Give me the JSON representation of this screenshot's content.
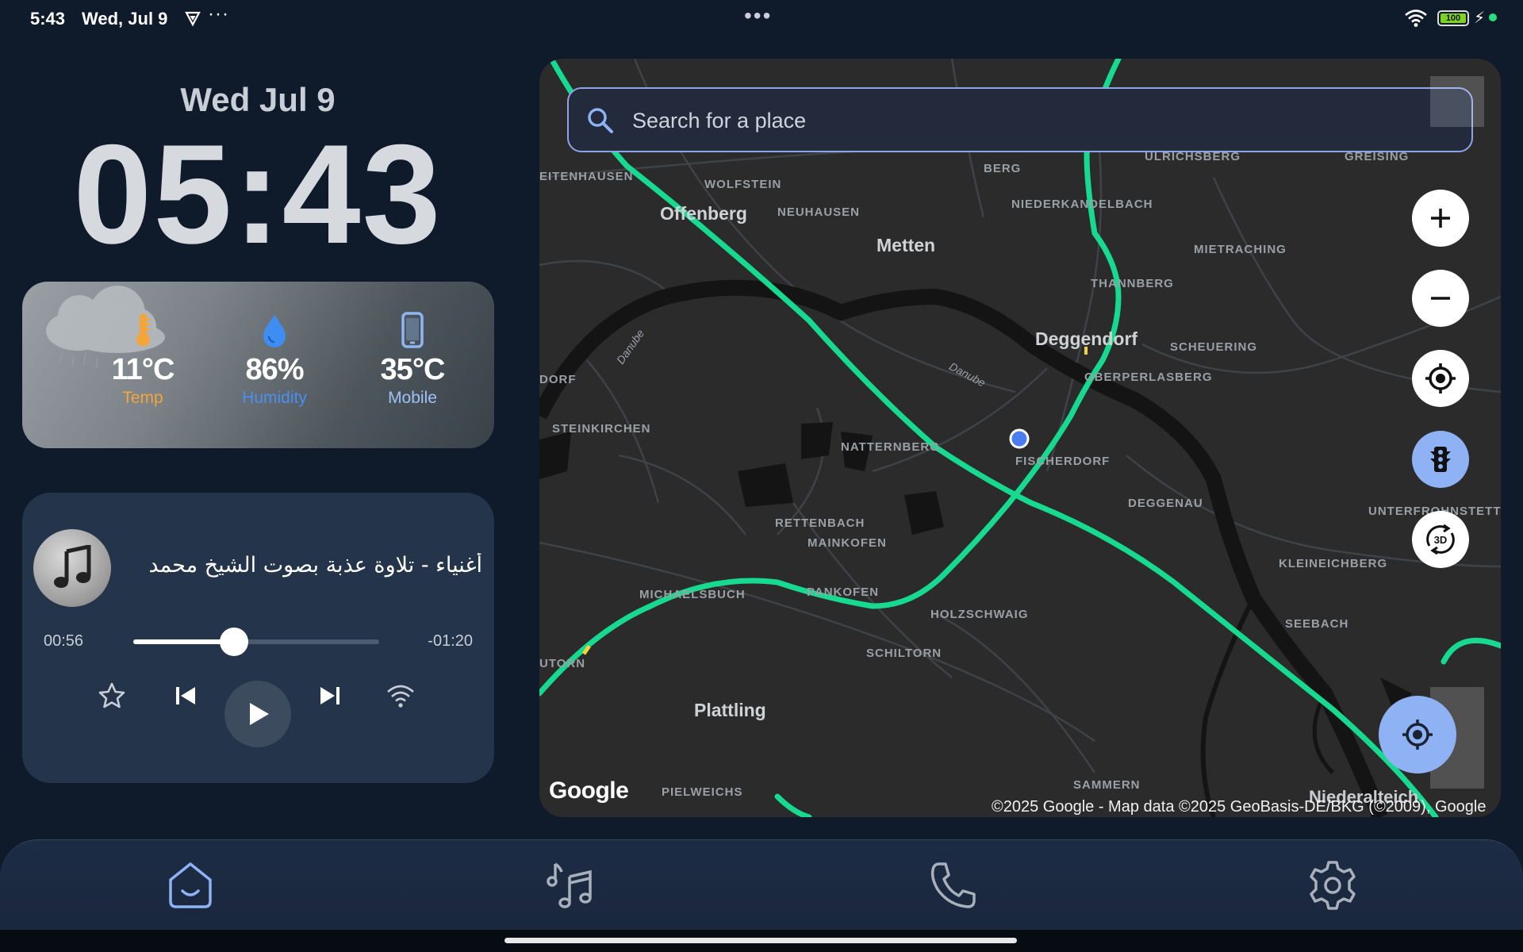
{
  "status_bar": {
    "time": "5:43",
    "date": "Wed, Jul 9",
    "more": "···",
    "center_dots": "•••",
    "battery": "100",
    "icons": [
      "vpn-shield-icon",
      "wifi-icon",
      "battery-icon",
      "charging-bolt-icon"
    ]
  },
  "clock": {
    "date": "Wed Jul 9",
    "time": "05:43"
  },
  "weather": {
    "condition_icon": "cloud-rain-icon",
    "items": [
      {
        "icon": "thermometer-icon",
        "value": "11°C",
        "label": "Temp",
        "color": "#f4a53a"
      },
      {
        "icon": "water-drop-icon",
        "value": "86%",
        "label": "Humidity",
        "color": "#4a8ff0"
      },
      {
        "icon": "phone-icon",
        "value": "35°C",
        "label": "Mobile",
        "color": "#9cc2f5"
      }
    ]
  },
  "music": {
    "title": "أغنياء - تلاوة عذبة بصوت الشيخ محمد",
    "elapsed": "00:56",
    "remaining": "-01:20",
    "progress": 0.41,
    "controls": [
      "star-icon",
      "previous-icon",
      "play-icon",
      "next-icon",
      "wifi-cast-icon"
    ]
  },
  "map": {
    "search_placeholder": "Search for a place",
    "cities": [
      {
        "name": "Offenberg"
      },
      {
        "name": "Metten"
      },
      {
        "name": "Deggendorf"
      },
      {
        "name": "Plattling"
      }
    ],
    "places": [
      "EITENHAUSEN",
      "WOLFSTEIN",
      "NEUHAUSEN",
      "BERG",
      "NIEDERKANDELBACH",
      "ULRICHSBERG",
      "GREISING",
      "MIETRACHING",
      "THANNBERG",
      "SCHEUERING",
      "OBERPERLASBERG",
      "DORF",
      "STEINKIRCHEN",
      "NATTERNBERG",
      "FISCHERDORF",
      "DEGGENAU",
      "UNTERFROHNSTETTEN",
      "RETTENBACH",
      "MAINKOFEN",
      "KLEINEICHBERG",
      "MICHAELSBUCH",
      "PANKOFEN",
      "HOLZSCHWAIG",
      "SEEBACH",
      "SCHILTORN",
      "UTORN",
      "PIELWEICHS",
      "SAMMERN",
      "Niederalteich",
      "Danube",
      "Danube"
    ],
    "logo": "Google",
    "copyright": "©2025 Google - Map data ©2025 GeoBasis-DE/BKG (©2009), Google",
    "buttons": [
      "zoom-in-icon",
      "zoom-out-icon",
      "locate-icon",
      "traffic-icon",
      "3d-rotate-icon"
    ],
    "three_d_label": "3D"
  },
  "nav": {
    "items": [
      "home-icon",
      "music-icon",
      "phone-icon",
      "settings-icon"
    ],
    "active": "home",
    "active_color": "#8fb2f5"
  }
}
